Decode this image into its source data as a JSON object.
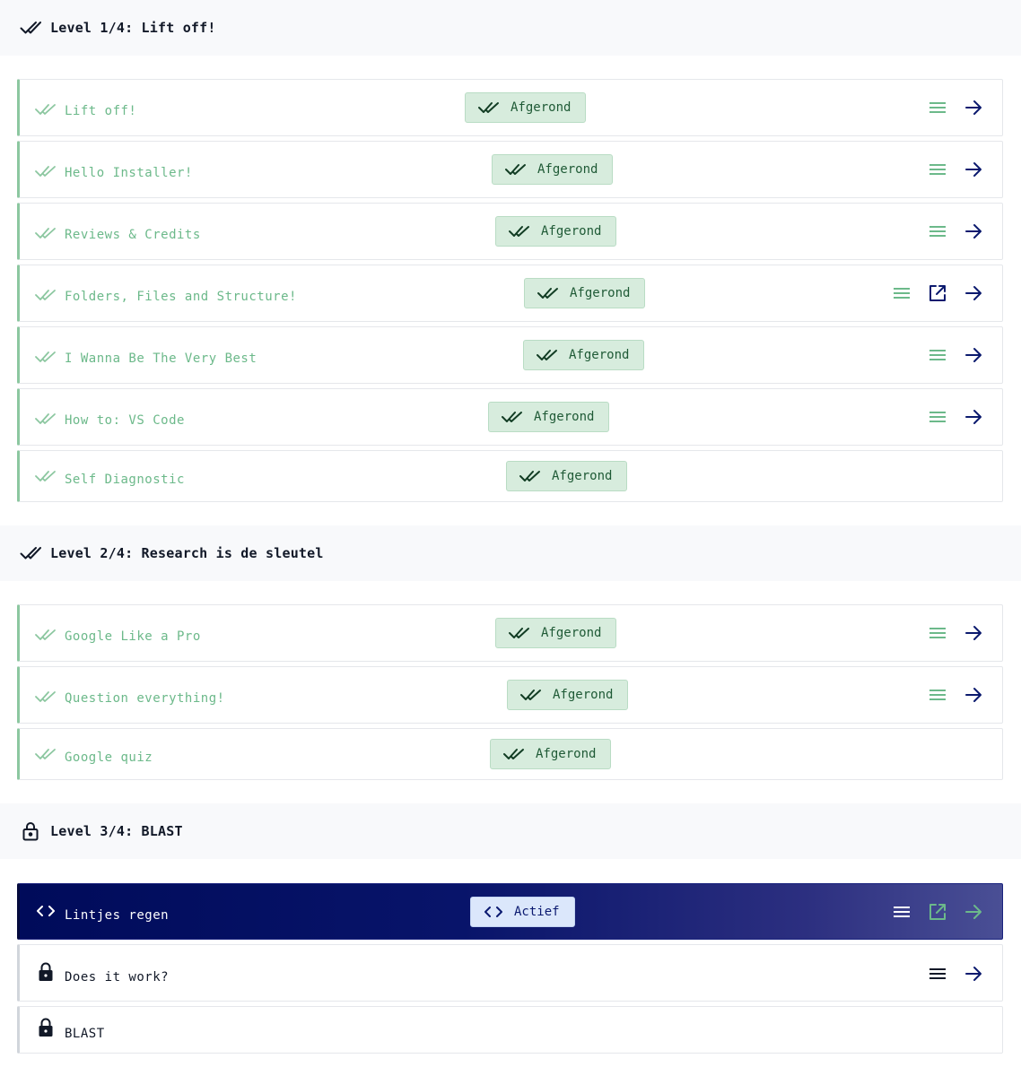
{
  "levels": [
    {
      "title": "Level 1/4: Lift off!",
      "icon": "double-check-icon",
      "items": [
        {
          "label": "Lift off!",
          "status": "Afgerond",
          "actions": [
            "menu",
            "arrow"
          ]
        },
        {
          "label": "Hello Installer!",
          "status": "Afgerond",
          "actions": [
            "menu",
            "arrow"
          ]
        },
        {
          "label": "Reviews & Credits",
          "status": "Afgerond",
          "actions": [
            "menu",
            "arrow"
          ]
        },
        {
          "label": "Folders, Files and Structure!",
          "status": "Afgerond",
          "actions": [
            "menu",
            "external",
            "arrow"
          ]
        },
        {
          "label": "I Wanna Be The Very Best",
          "status": "Afgerond",
          "actions": [
            "menu",
            "arrow"
          ]
        },
        {
          "label": "How to: VS Code",
          "status": "Afgerond",
          "actions": [
            "menu",
            "arrow"
          ]
        },
        {
          "label": "Self Diagnostic",
          "status": "Afgerond",
          "actions": []
        }
      ]
    },
    {
      "title": "Level 2/4: Research is de sleutel",
      "icon": "double-check-icon",
      "items": [
        {
          "label": "Google Like a Pro",
          "status": "Afgerond",
          "actions": [
            "menu",
            "arrow"
          ]
        },
        {
          "label": "Question everything!",
          "status": "Afgerond",
          "actions": [
            "menu",
            "arrow"
          ]
        },
        {
          "label": "Google quiz",
          "status": "Afgerond",
          "actions": []
        }
      ]
    },
    {
      "title": "Level 3/4: BLAST",
      "icon": "lock-open-icon",
      "items": [
        {
          "label": "Lintjes regen",
          "status": "Actief",
          "actions": [
            "menu",
            "external",
            "arrow"
          ]
        },
        {
          "label": "Does it work?",
          "status": "",
          "actions": [
            "menu",
            "arrow"
          ]
        },
        {
          "label": "BLAST",
          "status": "",
          "actions": []
        }
      ]
    }
  ],
  "colors": {
    "done_green": "#6cb98a",
    "badge_bg": "#d7ecdd",
    "navy": "#0b1a6e",
    "active_gradient_start": "#000b5a",
    "active_gradient_end": "#4a4f95"
  }
}
